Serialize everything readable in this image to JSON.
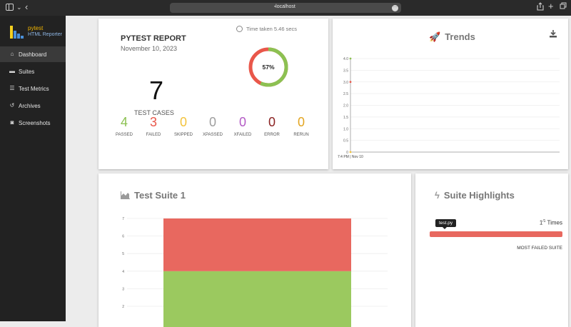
{
  "browser": {
    "url": "localhost"
  },
  "brand": {
    "line1": "pytest",
    "line2": "HTML Reporter"
  },
  "nav": {
    "items": [
      {
        "label": "Dashboard",
        "icon": "home-icon",
        "active": true
      },
      {
        "label": "Suites",
        "icon": "briefcase-icon",
        "active": false
      },
      {
        "label": "Test Metrics",
        "icon": "list-icon",
        "active": false
      },
      {
        "label": "Archives",
        "icon": "history-icon",
        "active": false
      },
      {
        "label": "Screenshots",
        "icon": "camera-icon",
        "active": false
      }
    ]
  },
  "summary": {
    "title": "PYTEST REPORT",
    "date": "November 10, 2023",
    "time_taken": "Time taken 5.46 secs",
    "pass_percent": 57,
    "pass_percent_label": "57%",
    "total": "7",
    "total_label": "TEST CASES",
    "stats": [
      {
        "value": "4",
        "label": "PASSED",
        "color": "#8cc152"
      },
      {
        "value": "3",
        "label": "FAILED",
        "color": "#e9574a"
      },
      {
        "value": "0",
        "label": "SKIPPED",
        "color": "#f3c33c"
      },
      {
        "value": "0",
        "label": "XPASSED",
        "color": "#9e9e9e"
      },
      {
        "value": "0",
        "label": "XFAILED",
        "color": "#b35ac5"
      },
      {
        "value": "0",
        "label": "ERROR",
        "color": "#8b2323"
      },
      {
        "value": "0",
        "label": "RERUN",
        "color": "#e3a521"
      }
    ],
    "colors": {
      "pass": "#8cc152",
      "fail": "#e9574a"
    }
  },
  "trends": {
    "title": "Trends",
    "icon": "rocket-icon",
    "download_icon": "download-icon",
    "chart_data": {
      "type": "line",
      "x": [
        "7:4 PM | Nov 10"
      ],
      "series": [
        {
          "values": [
            4
          ],
          "color": "#8cc152"
        },
        {
          "values": [
            3
          ],
          "color": "#e9574a"
        },
        {
          "values": [
            0
          ],
          "color": "#f3c33c"
        }
      ],
      "ylim": [
        0,
        4
      ],
      "y_ticks": [
        "0",
        "0.5",
        "1.0",
        "1.5",
        "2.0",
        "2.5",
        "3.0",
        "3.5",
        "4.0"
      ]
    }
  },
  "suite": {
    "title": "Test Suite 1",
    "icon": "area-chart-icon",
    "chart_data": {
      "type": "bar",
      "categories": [
        "Test Suite 1"
      ],
      "series": [
        {
          "values": [
            4
          ],
          "color": "#9bc95f"
        },
        {
          "values": [
            3
          ],
          "color": "#e8685f"
        }
      ],
      "y_ticks": [
        "2",
        "3",
        "4",
        "5",
        "6",
        "7"
      ]
    }
  },
  "highlights": {
    "title": "Suite Highlights",
    "icon": "bolt-icon",
    "tooltip": "test.py",
    "count": "1",
    "count_sup": "/1",
    "count_unit": "Times",
    "bar_color": "#e8685f",
    "caption": "MOST FAILED SUITE"
  }
}
